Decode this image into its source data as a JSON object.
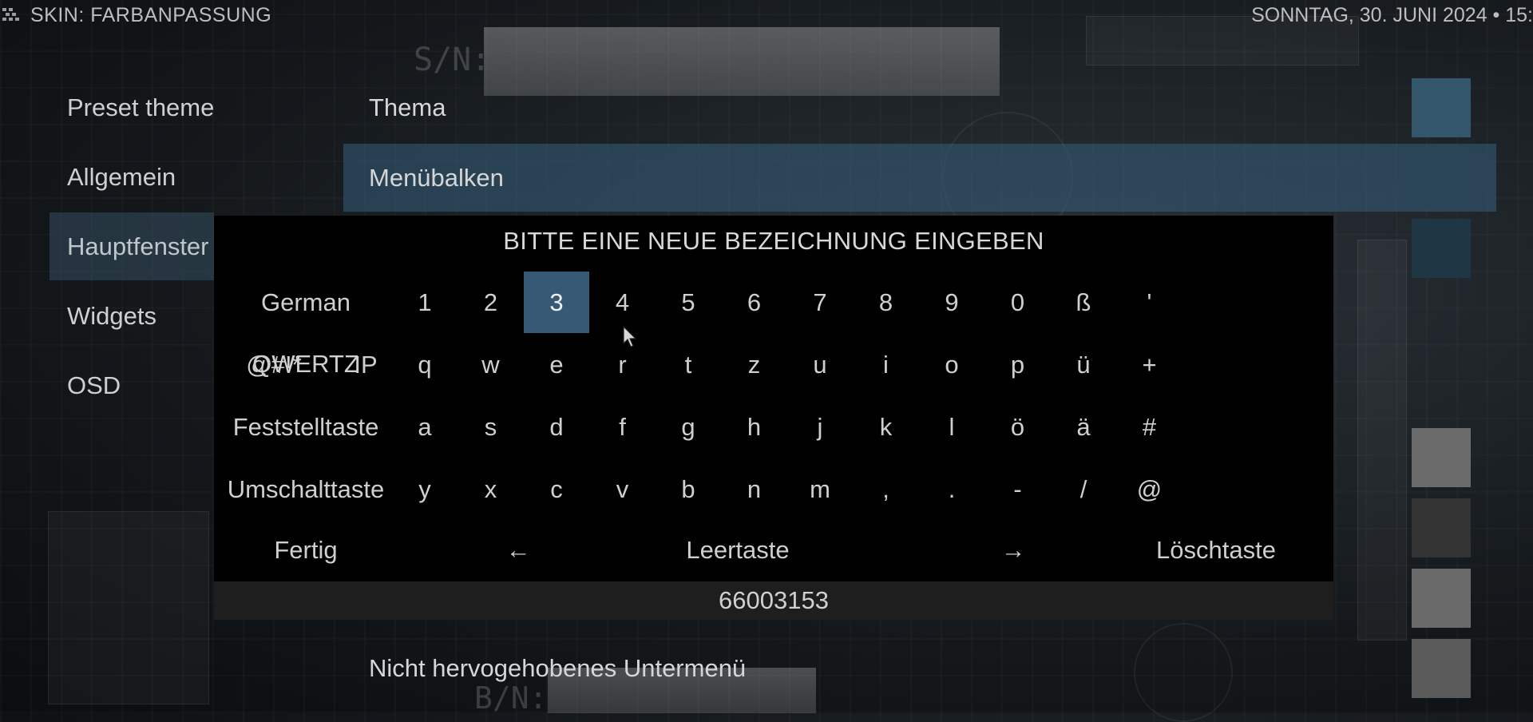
{
  "header": {
    "title": "SKIN: FARBANPASSUNG",
    "clock": "SONNTAG, 30. JUNI 2024 • 15:"
  },
  "background": {
    "sn_label": "S/N:",
    "bn_label": "B/N:"
  },
  "sidebar": {
    "items": [
      {
        "label": "Preset themes",
        "active": false
      },
      {
        "label": "Allgemein",
        "active": false
      },
      {
        "label": "Hauptfenster",
        "active": true
      },
      {
        "label": "Widgets",
        "active": false
      },
      {
        "label": "OSD",
        "active": false
      }
    ]
  },
  "settings": {
    "rows": [
      {
        "label": "Thema"
      },
      {
        "label": "Menübalken"
      },
      {
        "label": "Nicht hervogehobenes Untermenü"
      }
    ],
    "swatch_colors": [
      "#34566b",
      "#2a4656",
      "#1f3644",
      "#6b6b6b",
      "#333333",
      "#6a6a6a",
      "#5a5a5a"
    ]
  },
  "keyboard": {
    "title": "BITTE EINE NEUE BEZEICHNUNG EINGEBEN",
    "layout_button": "German QWERTZ",
    "symbols_button": "@#!*",
    "ip_button": "IP",
    "capslock_button": "Feststelltaste",
    "shift_button": "Umschalttaste",
    "done_button": "Fertig",
    "left_arrow": "←",
    "space_button": "Leertaste",
    "right_arrow": "→",
    "backspace_button": "Löschtaste",
    "rows": [
      [
        "1",
        "2",
        "3",
        "4",
        "5",
        "6",
        "7",
        "8",
        "9",
        "0",
        "ß",
        "'"
      ],
      [
        "q",
        "w",
        "e",
        "r",
        "t",
        "z",
        "u",
        "i",
        "o",
        "p",
        "ü",
        "+"
      ],
      [
        "a",
        "s",
        "d",
        "f",
        "g",
        "h",
        "j",
        "k",
        "l",
        "ö",
        "ä",
        "#"
      ],
      [
        "y",
        "x",
        "c",
        "v",
        "b",
        "n",
        "m",
        ",",
        ".",
        "-",
        "/",
        "@"
      ]
    ],
    "focused_key": "3",
    "input_value": "66003153"
  }
}
